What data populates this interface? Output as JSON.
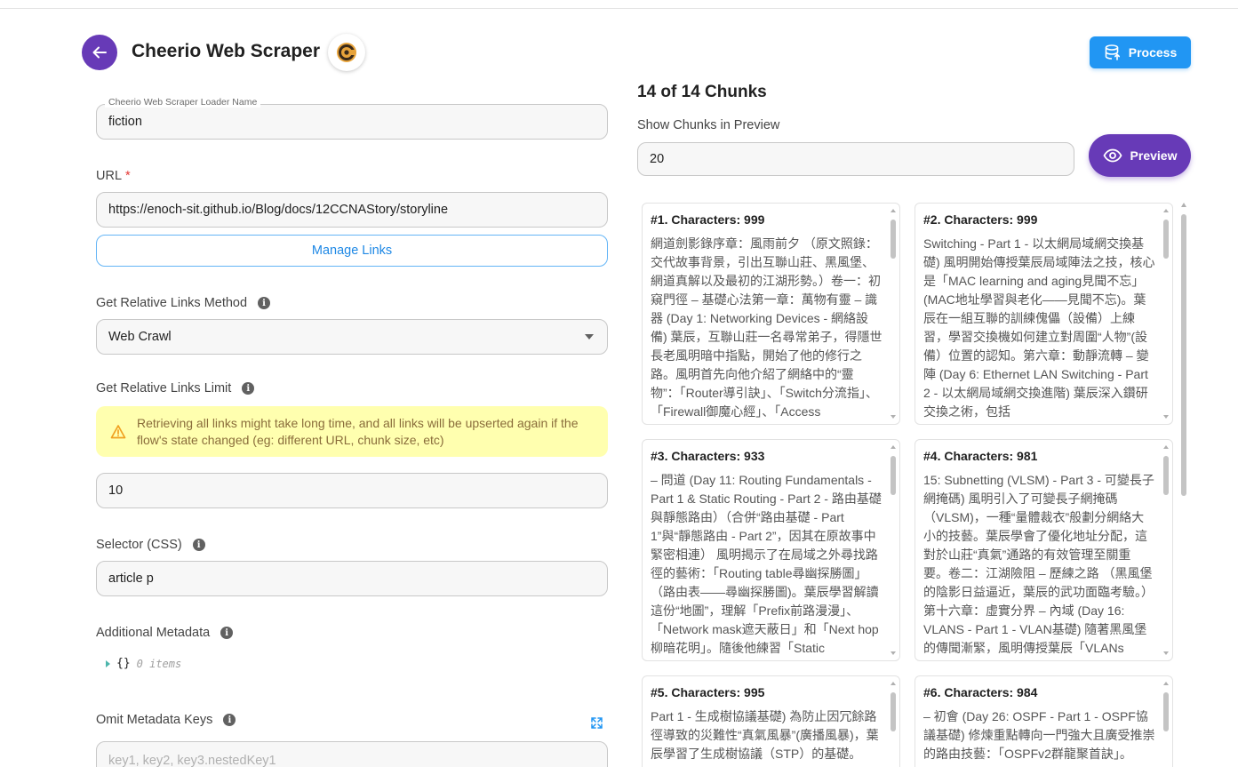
{
  "header": {
    "title": "Cheerio Web Scraper",
    "process_label": "Process"
  },
  "form": {
    "loader_name": {
      "label": "Cheerio Web Scraper Loader Name",
      "value": "fiction"
    },
    "url": {
      "label": "URL",
      "required_mark": "*",
      "value": "https://enoch-sit.github.io/Blog/docs/12CCNAStory/storyline"
    },
    "manage_links_label": "Manage Links",
    "relative_links_method": {
      "label": "Get Relative Links Method",
      "value": "Web Crawl"
    },
    "relative_links_limit": {
      "label": "Get Relative Links Limit",
      "warning": "Retrieving all links might take long time, and all links will be upserted again if the flow's state changed (eg: different URL, chunk size, etc)",
      "value": "10"
    },
    "selector": {
      "label": "Selector (CSS)",
      "value": "article p"
    },
    "additional_metadata": {
      "label": "Additional Metadata",
      "braces": "{}",
      "items_text": "0 items"
    },
    "omit_metadata_keys": {
      "label": "Omit Metadata Keys",
      "placeholder": "key1, key2, key3.nestedKey1"
    }
  },
  "preview": {
    "chunks_title": "14 of 14 Chunks",
    "show_label": "Show Chunks in Preview",
    "show_value": "20",
    "preview_label": "Preview"
  },
  "chunks": [
    {
      "title": "#1. Characters: 999",
      "text": "網道劍影錄序章：風雨前夕 （原文照錄：交代故事背景，引出互聯山莊、黑風堡、網道真解以及最初的江湖形勢。）卷一：初窺門徑 – 基礎心法第一章：萬物有靈 – 識器 (Day 1: Networking Devices - 網絡設備) 葉辰，互聯山莊一名尋常弟子，得隱世長老風明暗中指點，開始了他的修行之路。風明首先向他介紹了網絡中的“靈物”：「Router導引訣」、「Switch分流指」、「Firewall御魔心經」、「Access"
    },
    {
      "title": "#2. Characters: 999",
      "text": "Switching - Part 1 - 以太網局域網交換基礎) 風明開始傳授葉辰局域陣法之技，核心是「MAC learning and aging見聞不忘」(MAC地址學習與老化——見聞不忘)。葉辰在一組互聯的訓練傀儡（設備）上練習，學習交換機如何建立對周圍“人物”(設備）位置的認知。第六章：動靜流轉 – 變陣 (Day 6: Ethernet LAN Switching - Part 2 - 以太網局域網交換進階) 葉辰深入鑽研交換之術，包括"
    },
    {
      "title": "#3. Characters: 933",
      "text": "– 問道 (Day 11: Routing Fundamentals - Part 1 & Static Routing - Part 2 - 路由基礎與靜態路由）（合併“路由基礎 - Part 1”與“靜態路由 - Part 2”，因其在原故事中緊密相連） 風明揭示了在局域之外尋找路徑的藝術：「Routing table尋幽探勝圖」（路由表——尋幽探勝圖)。葉辰學習解讀這份“地圖”，理解「Prefix前路漫漫」、「Network mask遮天蔽日」和「Next hop柳暗花明」。隨後他練習「Static"
    },
    {
      "title": "#4. Characters: 981",
      "text": "15: Subnetting (VLSM) - Part 3 - 可變長子網掩碼) 風明引入了可變長子網掩碼（VLSM)，一種“量體裁衣”般劃分網絡大小的技藝。葉辰學會了優化地址分配，這對於山莊“真氣”通路的有效管理至關重要。卷二：江湖險阻 – 歷練之路 （黑風堡的陰影日益逼近，葉辰的武功面臨考驗。）第十六章：虛實分界 – 內域 (Day 16: VLANS - Part 1 - VLAN基礎) 隨著黑風堡的傳聞漸緊，風明傳授葉辰「VLANs"
    },
    {
      "title": "#5. Characters: 995",
      "text": "Part 1 - 生成樹協議基礎) 為防止因冗餘路徑導致的災難性“真氣風暴”(廣播風暴)，葉辰學習了生成樹協議（STP）的基礎。"
    },
    {
      "title": "#6. Characters: 984",
      "text": "– 初會 (Day 26: OSPF - Part 1 - OSPF協議基礎) 修煉重點轉向一門強大且廣受推崇的路由技藝：「OSPFv2群龍聚首訣」。"
    }
  ]
}
